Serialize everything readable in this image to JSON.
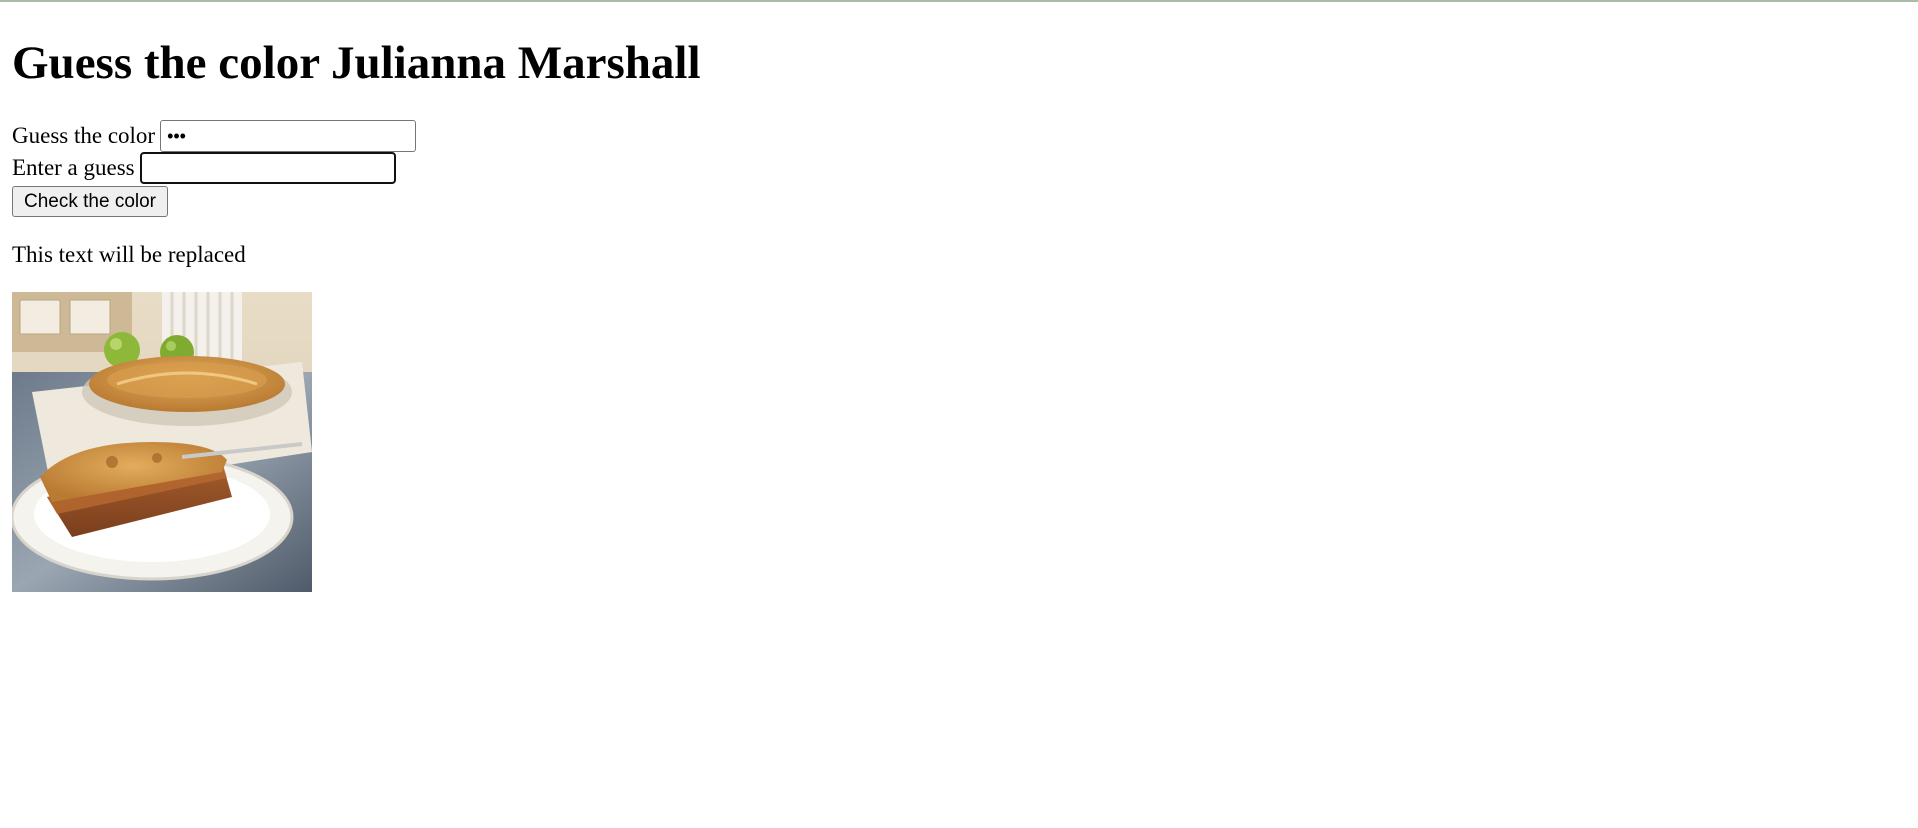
{
  "page": {
    "heading": "Guess the color Julianna Marshall"
  },
  "form": {
    "secret_label": "Guess the color",
    "secret_value": "...",
    "guess_label": "Enter a guess",
    "guess_value": "",
    "check_button_label": "Check the color"
  },
  "result": {
    "text": "This text will be replaced"
  },
  "image": {
    "alt": "Apple pie"
  }
}
